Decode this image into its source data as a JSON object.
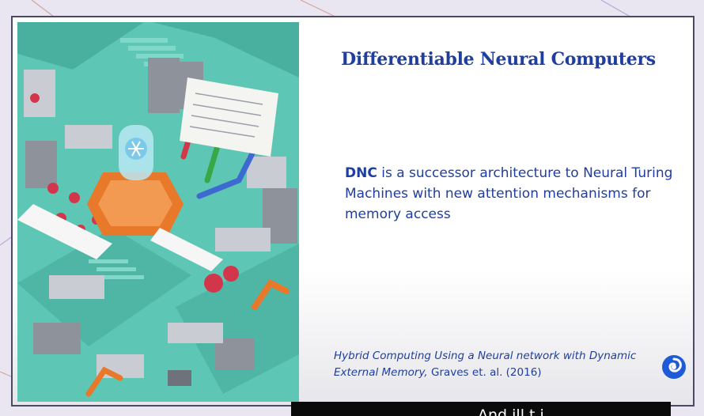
{
  "slide": {
    "title": "Differentiable Neural Computers",
    "body": {
      "highlight": "DNC",
      "text": " is a successor architecture to Neural Turing Machines with new attention mechanisms for memory access"
    },
    "citation": {
      "italic": "Hybrid Computing Using a Neural network with Dynamic External Memory,",
      "plain": " Graves et. al. (2016)"
    }
  },
  "caption": {
    "text": "And ill    t   i"
  },
  "colors": {
    "accent": "#1f3e9e",
    "illustration_teal": "#5ec6b4",
    "robot_orange": "#e8782a",
    "caption_bg": "#0a0a0a"
  },
  "icons": {
    "logo": "deepmind-logo-icon",
    "illustration": "isometric-factory-illustration"
  }
}
